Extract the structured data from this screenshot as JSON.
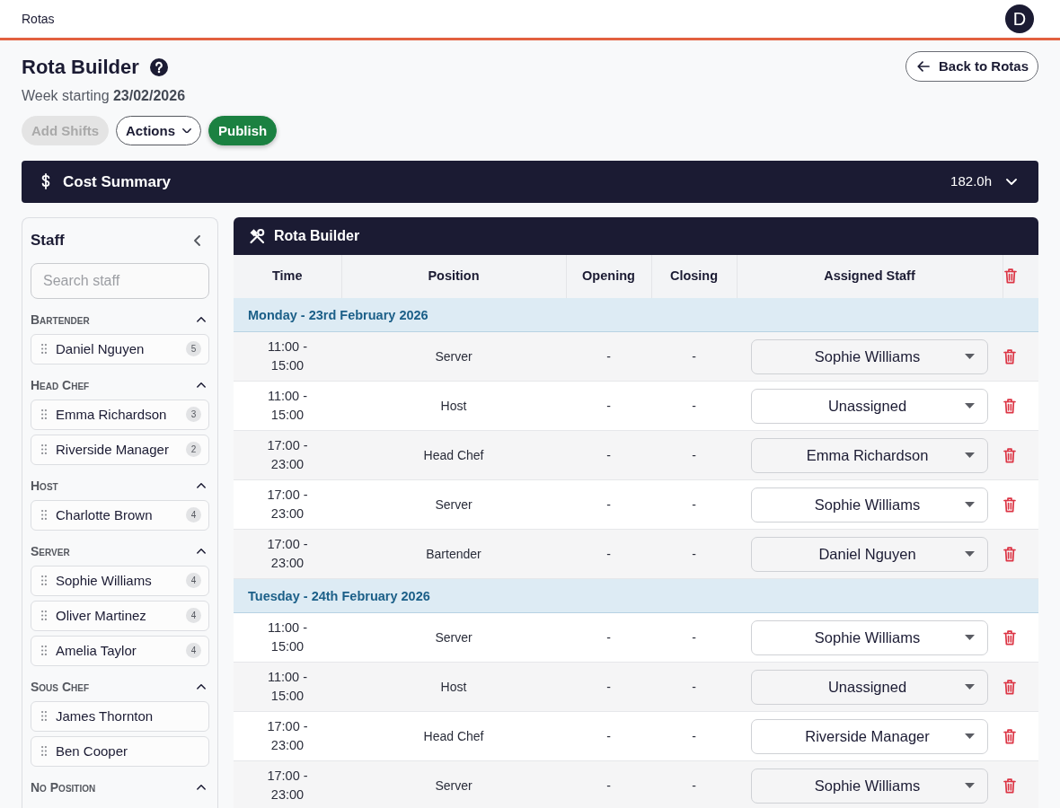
{
  "topbar": {
    "title": "Rotas",
    "avatar": "D"
  },
  "header": {
    "title": "Rota Builder",
    "subtitle": "Week starting **23/02/2026**",
    "back_button": "Back to Rotas"
  },
  "toolbar": [
    {
      "label": "Add Shifts",
      "kind": "plain",
      "disabled": true
    },
    {
      "label": "Actions",
      "kind": "dropdown",
      "disabled": false
    },
    {
      "label": "Publish",
      "kind": "primary",
      "disabled": false
    }
  ],
  "cost_summary": {
    "title": "Cost Summary",
    "total": "182.0h",
    "expanded": false
  },
  "staff_panel": {
    "title": "Staff",
    "search": {
      "placeholder": "Search staff"
    },
    "groups": [
      {
        "name": "Bartender",
        "expanded": true,
        "members": [
          {
            "name": "Daniel Nguyen",
            "count": "5"
          }
        ]
      },
      {
        "name": "Head Chef",
        "expanded": true,
        "members": [
          {
            "name": "Emma Richardson",
            "count": "3"
          },
          {
            "name": "Riverside Manager",
            "count": "2"
          }
        ]
      },
      {
        "name": "Host",
        "expanded": true,
        "members": [
          {
            "name": "Charlotte Brown",
            "count": "4"
          }
        ]
      },
      {
        "name": "Server",
        "expanded": true,
        "members": [
          {
            "name": "Sophie Williams",
            "count": "4"
          },
          {
            "name": "Oliver Martinez",
            "count": "4"
          },
          {
            "name": "Amelia Taylor",
            "count": "4"
          }
        ]
      },
      {
        "name": "Sous Chef",
        "expanded": true,
        "members": [
          {
            "name": "James Thornton"
          },
          {
            "name": "Ben Cooper"
          }
        ]
      },
      {
        "name": "No Position",
        "expanded": true
      }
    ]
  },
  "rota": {
    "title": "Rota Builder",
    "columns": [
      "Time",
      "Position",
      "Opening",
      "Closing",
      "Assigned Staff"
    ],
    "days": [
      {
        "label": "Monday - 23rd February 2026",
        "shifts": [
          {
            "time": "11:00 - 15:00",
            "position": "Server",
            "opening": "-",
            "closing": "-",
            "assigned": "Sophie Williams"
          },
          {
            "time": "11:00 - 15:00",
            "position": "Host",
            "opening": "-",
            "closing": "-",
            "assigned": "Unassigned"
          },
          {
            "time": "17:00 - 23:00",
            "position": "Head Chef",
            "opening": "-",
            "closing": "-",
            "assigned": "Emma Richardson"
          },
          {
            "time": "17:00 - 23:00",
            "position": "Server",
            "opening": "-",
            "closing": "-",
            "assigned": "Sophie Williams"
          },
          {
            "time": "17:00 - 23:00",
            "position": "Bartender",
            "opening": "-",
            "closing": "-",
            "assigned": "Daniel Nguyen"
          }
        ]
      },
      {
        "label": "Tuesday - 24th February 2026",
        "shifts": [
          {
            "time": "11:00 - 15:00",
            "position": "Server",
            "opening": "-",
            "closing": "-",
            "assigned": "Sophie Williams"
          },
          {
            "time": "11:00 - 15:00",
            "position": "Host",
            "opening": "-",
            "closing": "-",
            "assigned": "Unassigned"
          },
          {
            "time": "17:00 - 23:00",
            "position": "Head Chef",
            "opening": "-",
            "closing": "-",
            "assigned": "Riverside Manager"
          },
          {
            "time": "17:00 - 23:00",
            "position": "Server",
            "opening": "-",
            "closing": "-",
            "assigned": "Sophie Williams"
          }
        ]
      }
    ]
  }
}
